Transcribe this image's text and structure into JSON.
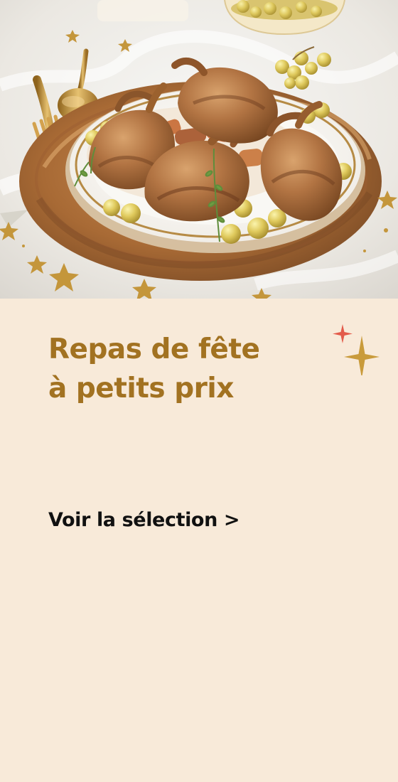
{
  "hero_image": {
    "alt": "Repas de fête à petits prix"
  },
  "headline": {
    "line1": "Repas de fête",
    "line2": "à petits prix"
  },
  "cta": {
    "label": "Voir la sélection >"
  },
  "colors": {
    "background": "#f8ead9",
    "headline": "#a27221",
    "cta_text": "#111111",
    "sparkle_red": "#e35b4a",
    "sparkle_gold": "#c99b3b"
  }
}
